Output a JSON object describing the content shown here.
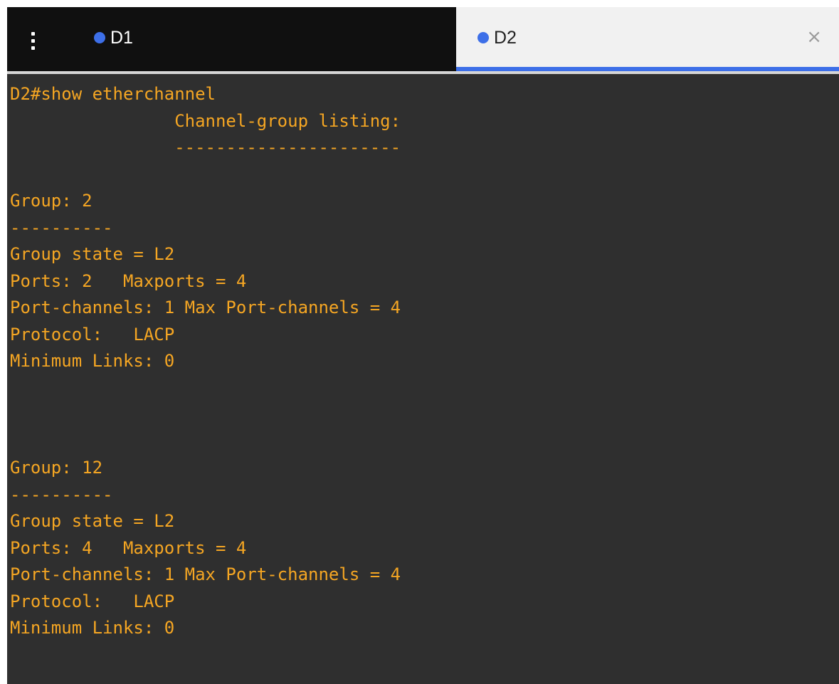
{
  "tabs": [
    {
      "label": "D1",
      "active": false
    },
    {
      "label": "D2",
      "active": true
    }
  ],
  "tab_close_glyph": "×",
  "colors": {
    "tab_dot": "#3d6fe8",
    "active_underline": "#3d6fe8",
    "terminal_bg": "#2f2f2f",
    "terminal_text": "#f5a623"
  },
  "icons": {
    "menu": "vertical-ellipsis-icon",
    "tab_status": "dot-icon",
    "close": "close-icon"
  },
  "terminal": {
    "lines": [
      "D2#show etherchannel",
      "                Channel-group listing:",
      "                ----------------------",
      "",
      "Group: 2",
      "----------",
      "Group state = L2",
      "Ports: 2   Maxports = 4",
      "Port-channels: 1 Max Port-channels = 4",
      "Protocol:   LACP",
      "Minimum Links: 0",
      "",
      "",
      "",
      "Group: 12",
      "----------",
      "Group state = L2",
      "Ports: 4   Maxports = 4",
      "Port-channels: 1 Max Port-channels = 4",
      "Protocol:   LACP",
      "Minimum Links: 0"
    ]
  }
}
